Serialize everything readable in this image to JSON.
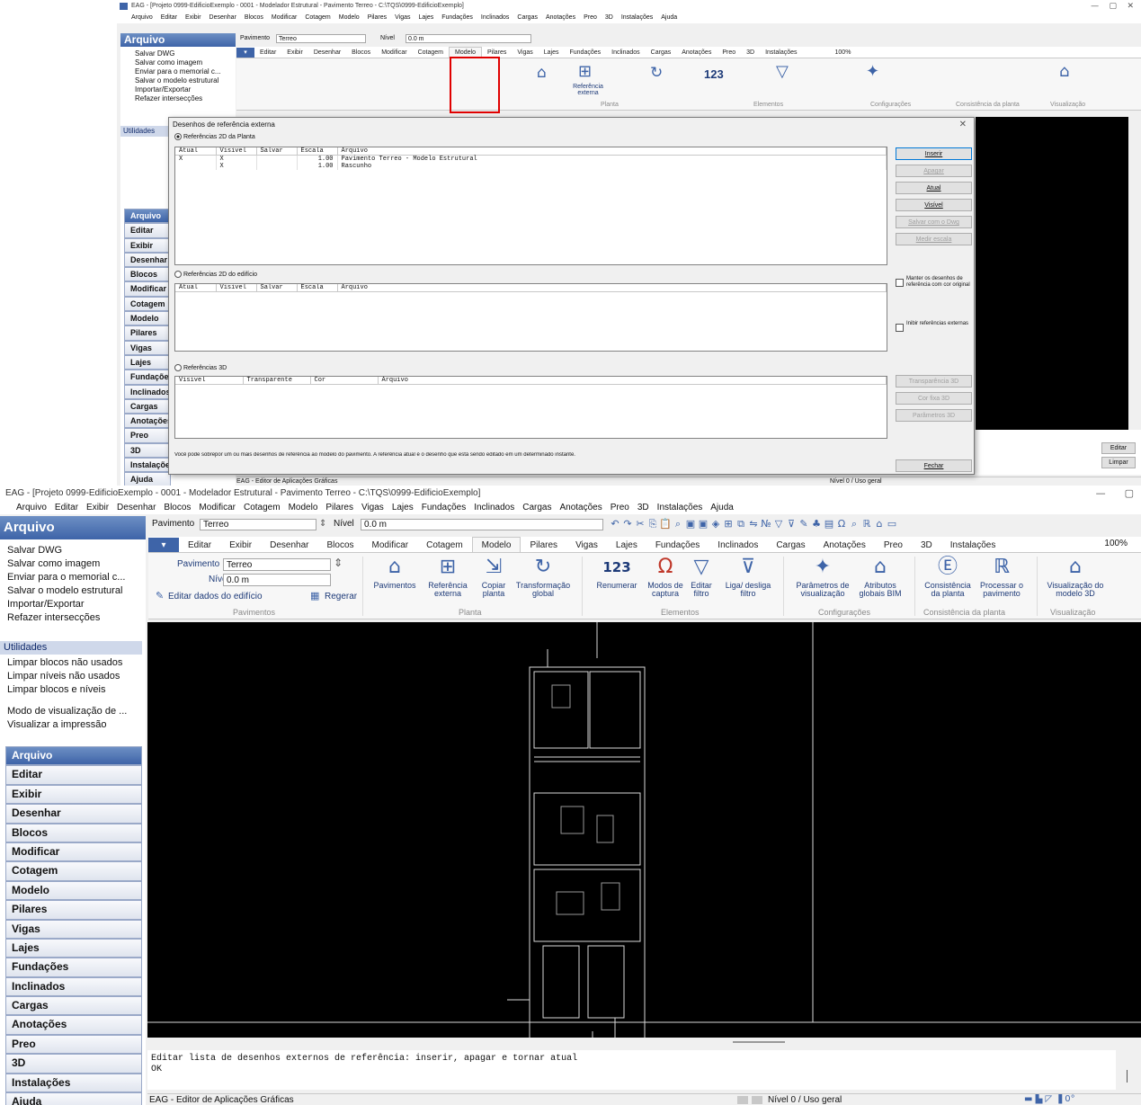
{
  "top": {
    "title": "EAG - [Projeto 0999-EdificioExemplo - 0001 - Modelador Estrutural - Pavimento Terreo - C:\\TQS\\0999-EdificioExemplo]",
    "menu": [
      "Arquivo",
      "Editar",
      "Exibir",
      "Desenhar",
      "Blocos",
      "Modificar",
      "Cotagem",
      "Modelo",
      "Pilares",
      "Vigas",
      "Lajes",
      "Fundações",
      "Inclinados",
      "Cargas",
      "Anotações",
      "Preo",
      "3D",
      "Instalações",
      "Ajuda"
    ],
    "zoom": "100%",
    "status": "EAG - Editor de Aplicações Gráficas",
    "status_level": "Nível 0 / Uso geral",
    "side_buttons": [
      "Editar",
      "Limpar"
    ]
  },
  "dialog": {
    "title": "Desenhos de referência externa",
    "section_2d_plant": "Referências 2D da Planta",
    "section_2d_building": "Referências 2D do edifício",
    "section_3d": "Referências 3D",
    "columns_2d": [
      "Atual",
      "Visivel",
      "Salvar",
      "Escala",
      "Arquivo"
    ],
    "columns_3d": [
      "Visivel",
      "Transparente",
      "Cor",
      "Arquivo"
    ],
    "rows_2d": [
      {
        "atual": "X",
        "visivel": "X",
        "salvar": "",
        "escala": "1.00",
        "arquivo": "Pavimento Terreo - Modelo Estrutural"
      },
      {
        "atual": "",
        "visivel": "X",
        "salvar": "",
        "escala": "1.00",
        "arquivo": "Rascunho"
      }
    ],
    "buttons": [
      "Inserir",
      "Apagar",
      "Atual",
      "Visível",
      "Salvar com o Dwg",
      "Medir escala"
    ],
    "chk_keep": "Manter os desenhos de referência com cor original",
    "chk_inhibit": "Inibir referências externas",
    "buttons_3d": [
      "Transparência 3D",
      "Cor fixa 3D",
      "Parâmetros 3D"
    ],
    "info": "Você pode sobrepor um ou mais desenhos de referência ao modelo do pavimento. A referência atual é o desenho que está sendo editado em um determinado instante.",
    "close": "Fechar"
  },
  "main": {
    "title": "EAG - [Projeto 0999-EdificioExemplo - 0001 - Modelador Estrutural - Pavimento Terreo - C:\\TQS\\0999-EdificioExemplo]",
    "menu": [
      "Arquivo",
      "Editar",
      "Exibir",
      "Desenhar",
      "Blocos",
      "Modificar",
      "Cotagem",
      "Modelo",
      "Pilares",
      "Vigas",
      "Lajes",
      "Fundações",
      "Inclinados",
      "Cargas",
      "Anotações",
      "Preo",
      "3D",
      "Instalações",
      "Ajuda"
    ],
    "toolbar": {
      "pav_label": "Pavimento",
      "pav_value": "Terreo",
      "nivel_label": "Nível",
      "nivel_value": "0.0 m"
    },
    "ribbon_tabs": [
      "Editar",
      "Exibir",
      "Desenhar",
      "Blocos",
      "Modificar",
      "Cotagem",
      "Modelo",
      "Pilares",
      "Vigas",
      "Lajes",
      "Fundações",
      "Inclinados",
      "Cargas",
      "Anotações",
      "Preo",
      "3D",
      "Instalações"
    ],
    "zoom": "100%",
    "ribbon": {
      "pav_label": "Pavimento",
      "pav_value": "Terreo",
      "nivel_label": "Nível",
      "nivel_value": "0.0 m",
      "edit_building": "Editar dados do edifício",
      "regerar": "Regerar",
      "group_pav": "Pavimentos",
      "pavimentos": "Pavimentos",
      "ref_ext": "Referência externa",
      "copiar": "Copiar planta",
      "transf": "Transformação global",
      "group_planta": "Planta",
      "renumerar": "Renumerar",
      "modos": "Modos de captura",
      "editar_filtro": "Editar filtro",
      "liga": "Liga/ desliga filtro",
      "group_elem": "Elementos",
      "param": "Parâmetros de visualização",
      "atrib": "Atributos globais BIM",
      "group_config": "Configurações",
      "consist": "Consistência da planta",
      "processar": "Processar o pavimento",
      "group_consist": "Consistência da planta",
      "visual": "Visualização do modelo 3D",
      "group_visual": "Visualização"
    },
    "left": {
      "title": "Arquivo",
      "items": [
        "Salvar DWG",
        "Salvar como imagem",
        "Enviar para o memorial c...",
        "Salvar o modelo estrutural",
        "Importar/Exportar",
        "Refazer intersecções"
      ],
      "util_title": "Utilidades",
      "util_items": [
        "Limpar blocos não usados",
        "Limpar níveis não usados",
        "Limpar blocos e níveis"
      ],
      "view_items": [
        "Modo de visualização de ...",
        "Visualizar a impressão"
      ],
      "categories": [
        "Arquivo",
        "Editar",
        "Exibir",
        "Desenhar",
        "Blocos",
        "Modificar",
        "Cotagem",
        "Modelo",
        "Pilares",
        "Vigas",
        "Lajes",
        "Fundações",
        "Inclinados",
        "Cargas",
        "Anotações",
        "Preo",
        "3D",
        "Instalações",
        "Ajuda"
      ]
    },
    "command": [
      "Editar lista de desenhos externos de referência: inserir, apagar e tornar atual",
      "OK"
    ],
    "status": "EAG - Editor de Aplicações Gráficas",
    "status_level": "Nível 0 / Uso geral"
  },
  "colors": {
    "accent": "#3e64a8",
    "highlight": "#e00000",
    "canvas": "#000000"
  }
}
